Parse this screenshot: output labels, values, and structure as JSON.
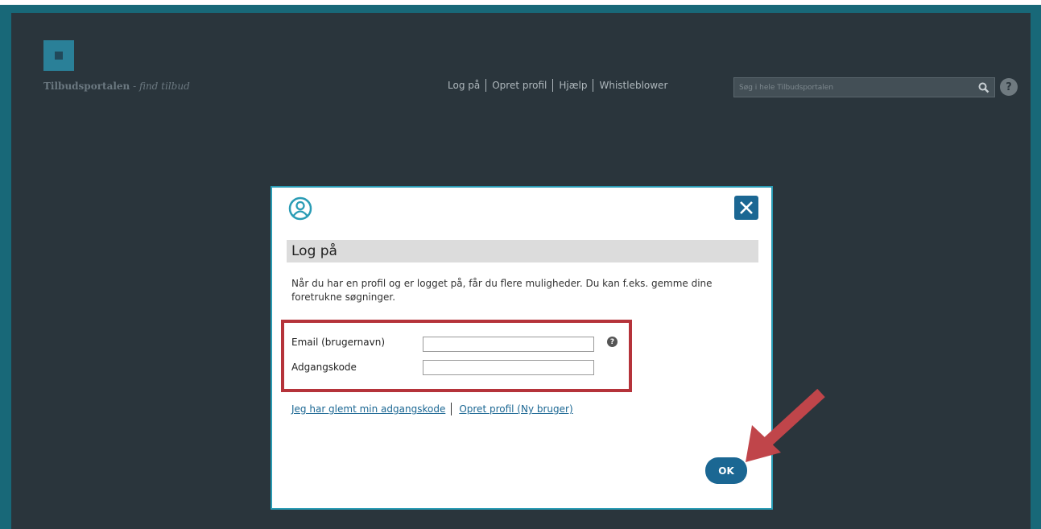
{
  "header": {
    "site_title": "Tilbudsportalen",
    "site_tagline": " - find tilbud",
    "nav": [
      "Log på",
      "Opret profil",
      "Hjælp",
      "Whistleblower"
    ],
    "search_placeholder": "Søg i hele Tilbudsportalen",
    "help_label": "?"
  },
  "modal": {
    "heading": "Log på",
    "description": "Når du har en profil og er logget på, får du flere muligheder. Du kan f.eks. gemme dine foretrukne søgninger.",
    "email_label": "Email (brugernavn)",
    "email_value": "",
    "password_label": "Adgangskode",
    "password_value": "",
    "info_label": "?",
    "forgot_link": "Jeg har glemt min adgangskode",
    "create_link": "Opret profil (Ny bruger)",
    "ok_label": "OK"
  },
  "icons": {
    "user": "user-icon",
    "close": "close-icon",
    "search": "search-icon",
    "arrow": "arrow-annotation"
  },
  "colors": {
    "frame": "#186878",
    "background": "#2a353c",
    "accent": "#1b6793",
    "highlight": "#b5333a"
  }
}
